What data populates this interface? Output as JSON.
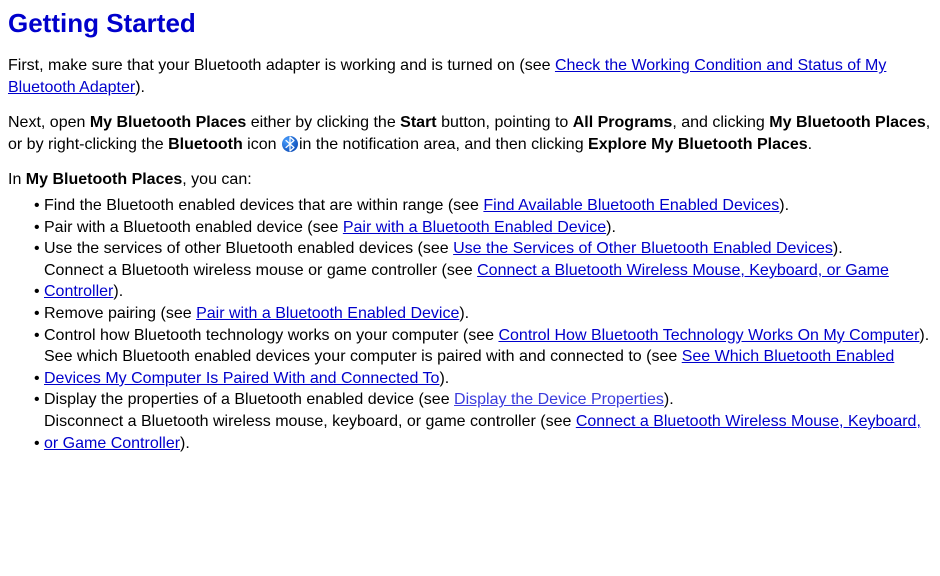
{
  "title": "Getting Started",
  "p1_a": "First, make sure that your Bluetooth adapter is working and is turned on (see ",
  "p1_link": "Check the Working Condition and Status of My Bluetooth Adapter",
  "p1_b": ").",
  "p2_a": "Next, open ",
  "p2_b1": "My Bluetooth Places",
  "p2_c": " either by clicking the ",
  "p2_b2": "Start",
  "p2_d": " button, pointing to ",
  "p2_b3": "All Programs",
  "p2_e": ", and clicking ",
  "p2_b4": "My Bluetooth Places",
  "p2_f": ", or by right-clicking the ",
  "p2_b5": "Bluetooth",
  "p2_g": " icon ",
  "p2_h": "in the notification area, and then clicking ",
  "p2_b6": "Explore My Bluetooth Places",
  "p2_i": ".",
  "lead_a": "In ",
  "lead_b": "My Bluetooth Places",
  "lead_c": ", you can:",
  "bullet": "•",
  "li1_a": "Find the Bluetooth enabled devices that are within range (see ",
  "li1_link": "Find Available Bluetooth Enabled Devices",
  "li1_b": ").",
  "li2_a": "Pair with a Bluetooth enabled device (see ",
  "li2_link": "Pair with a Bluetooth Enabled Device",
  "li2_b": ").",
  "li3_a": "Use the services of other Bluetooth enabled devices (see ",
  "li3_link": "Use the Services of Other Bluetooth Enabled Devices",
  "li3_b": ").",
  "li4_a": "Connect a Bluetooth wireless mouse or game controller (see ",
  "li4_link": "Connect a Bluetooth Wireless Mouse, Keyboard, or Game Controller",
  "li4_b": ").",
  "li5_a": "Remove pairing (see ",
  "li5_link": "Pair with a Bluetooth Enabled Device",
  "li5_b": ").",
  "li6_a": "Control how Bluetooth technology works on your computer (see ",
  "li6_link": "Control How Bluetooth Technology Works On My Computer",
  "li6_b": ").",
  "li7_a": "See which Bluetooth enabled devices your computer is paired with and connected to (see ",
  "li7_link": "See Which Bluetooth Enabled Devices My Computer Is Paired With and Connected To",
  "li7_b": ").",
  "li8_a": "Display the properties of a Bluetooth enabled device (see ",
  "li8_link": "Display the Device Properties",
  "li8_b": ").",
  "li9_a": "Disconnect a Bluetooth wireless mouse, keyboard, or game controller (see ",
  "li9_link": "Connect a Bluetooth Wireless Mouse, Keyboard, or Game Controller",
  "li9_b": ")."
}
